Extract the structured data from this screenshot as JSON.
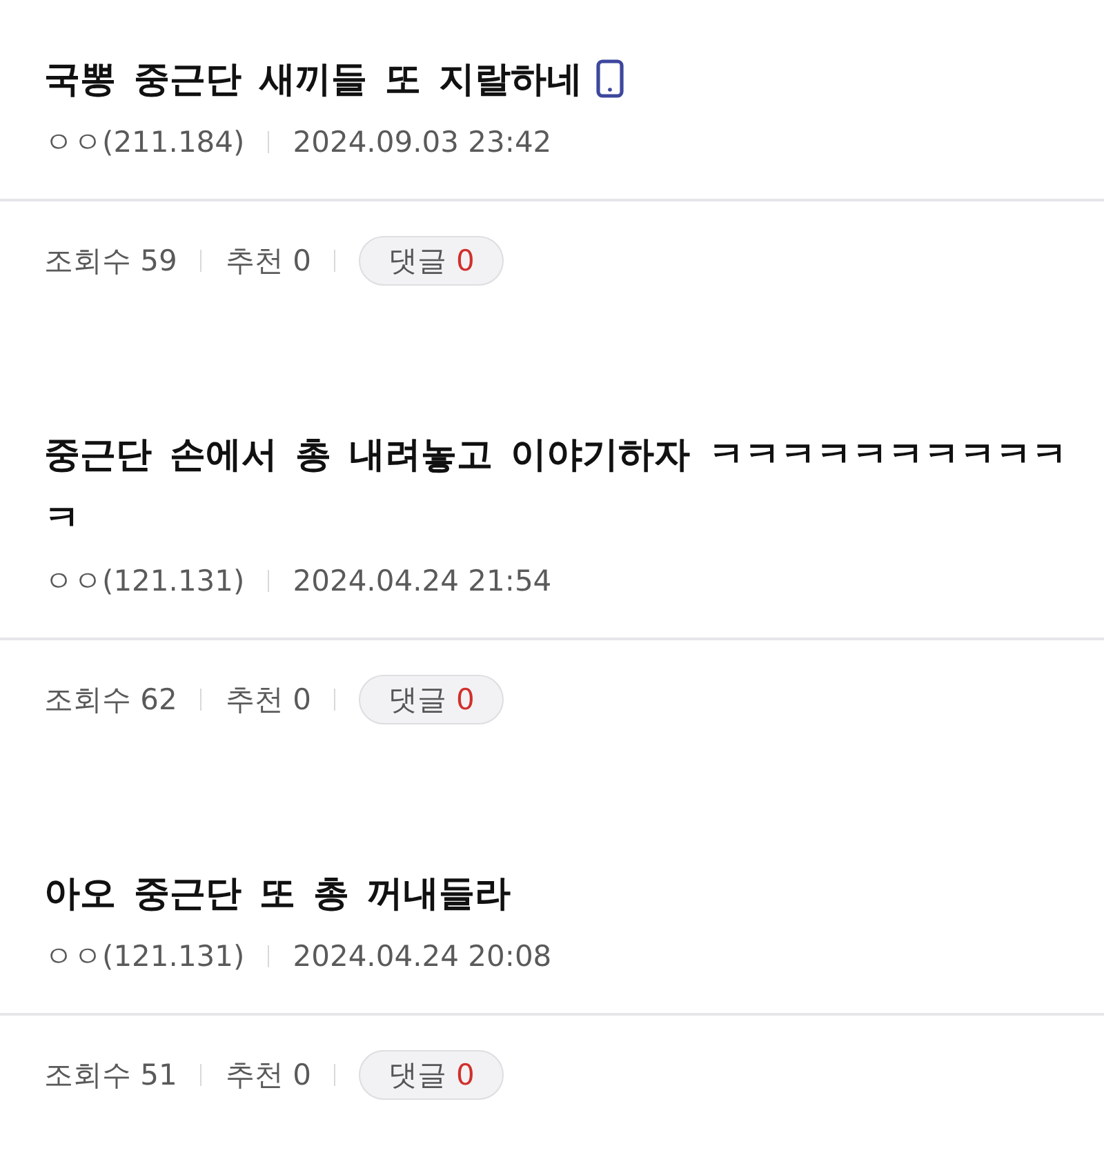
{
  "posts": [
    {
      "title": "국뽕 중근단 새끼들 또 지랄하네",
      "mobile": true,
      "author": "ㅇㅇ(211.184)",
      "date": "2024.09.03 23:42",
      "views": "조회수 59",
      "recommends": "추천 0",
      "comments": {
        "label": "댓글",
        "count": "0"
      }
    },
    {
      "title": "중근단 손에서 총 내려놓고 이야기하자 ㅋㅋㅋㅋㅋㅋㅋㅋㅋㅋㅋ",
      "mobile": false,
      "author": "ㅇㅇ(121.131)",
      "date": "2024.04.24 21:54",
      "views": "조회수 62",
      "recommends": "추천 0",
      "comments": {
        "label": "댓글",
        "count": "0"
      }
    },
    {
      "title": "아오 중근단 또 총 꺼내들라",
      "mobile": false,
      "author": "ㅇㅇ(121.131)",
      "date": "2024.04.24 20:08",
      "views": "조회수 51",
      "recommends": "추천 0",
      "comments": {
        "label": "댓글",
        "count": "0"
      }
    }
  ]
}
